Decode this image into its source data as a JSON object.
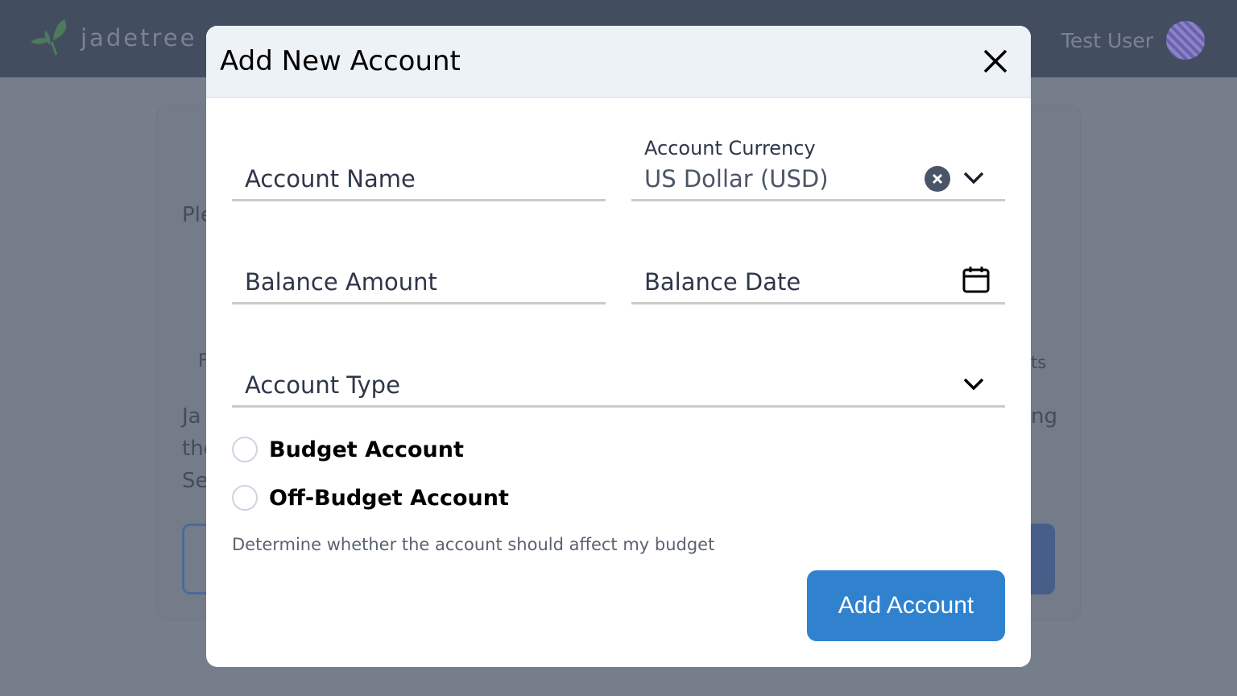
{
  "app": {
    "brand": "jadetree",
    "user_name": "Test User"
  },
  "background_fragments": [
    "Ple",
    "F",
    "Ja",
    "the",
    "Se",
    "ts",
    "ng"
  ],
  "modal": {
    "title": "Add New Account",
    "fields": {
      "account_name": {
        "placeholder": "Account Name"
      },
      "currency": {
        "label": "Account Currency",
        "value": "US Dollar (USD)"
      },
      "balance_amount": {
        "placeholder": "Balance Amount"
      },
      "balance_date": {
        "placeholder": "Balance Date"
      },
      "account_type": {
        "placeholder": "Account Type"
      }
    },
    "radios": [
      {
        "label": "Budget Account",
        "checked": false
      },
      {
        "label": "Off-Budget Account",
        "checked": false
      }
    ],
    "help_text": "Determine whether the account should affect my budget",
    "submit_label": "Add Account"
  },
  "colors": {
    "primary": "#3182ce",
    "header": "#434d60",
    "overlay": "#767e8c"
  }
}
